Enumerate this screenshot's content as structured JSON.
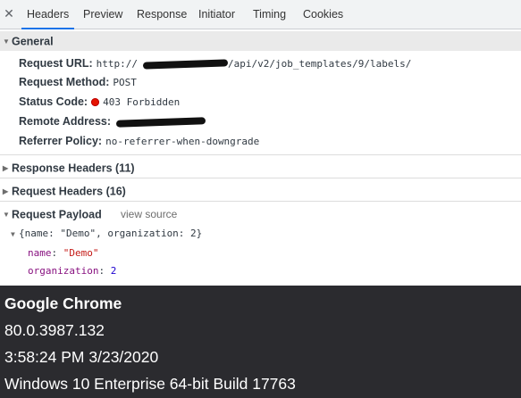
{
  "tabs": {
    "close_glyph": "✕",
    "items": [
      "Headers",
      "Preview",
      "Response",
      "Initiator",
      "Timing",
      "Cookies"
    ],
    "active": "Headers"
  },
  "general": {
    "label": "General",
    "request_url_label": "Request URL:",
    "request_url_prefix": "http://",
    "request_url_suffix": "/api/v2/job_templates/9/labels/",
    "request_method_label": "Request Method:",
    "request_method_value": "POST",
    "status_code_label": "Status Code:",
    "status_code_value": "403 Forbidden",
    "status_color": "#e51400",
    "remote_address_label": "Remote Address:",
    "referrer_policy_label": "Referrer Policy:",
    "referrer_policy_value": "no-referrer-when-downgrade"
  },
  "response_headers": {
    "label": "Response Headers (11)"
  },
  "request_headers": {
    "label": "Request Headers (16)"
  },
  "request_payload": {
    "label": "Request Payload",
    "view_source": "view source",
    "summary": "{name: \"Demo\", organization: 2}",
    "fields": [
      {
        "key": "name",
        "sep": ": ",
        "value": "\"Demo\""
      },
      {
        "key": "organization",
        "sep": ": ",
        "value": "2"
      }
    ]
  },
  "about": {
    "product": "Google Chrome",
    "version": "80.0.3987.132",
    "datetime": "3:58:24 PM 3/23/2020",
    "os": "Windows 10 Enterprise 64-bit Build 17763"
  },
  "colors": {
    "accent": "#1a73e8",
    "footer_bg": "#2b2b2f"
  }
}
